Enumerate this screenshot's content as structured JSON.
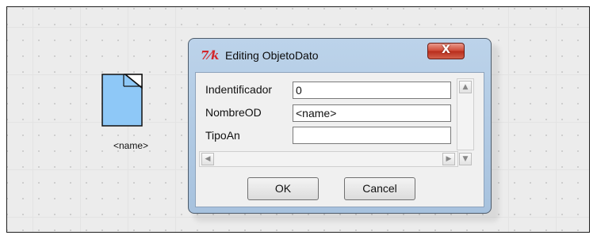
{
  "canvas": {
    "element": {
      "label": "<name>",
      "icon": "document-icon",
      "fill_color": "#8ec8f7"
    }
  },
  "dialog": {
    "title": "Editing ObjetoDato",
    "app_icon_glyph": "7⁄k",
    "close_label": "X",
    "fields": [
      {
        "label": "Indentificador",
        "value": "0"
      },
      {
        "label": "NombreOD",
        "value": "<name>"
      },
      {
        "label": "TipoAn",
        "value": ""
      }
    ],
    "ok_label": "OK",
    "cancel_label": "Cancel",
    "close_button_color": "#c8412f"
  }
}
